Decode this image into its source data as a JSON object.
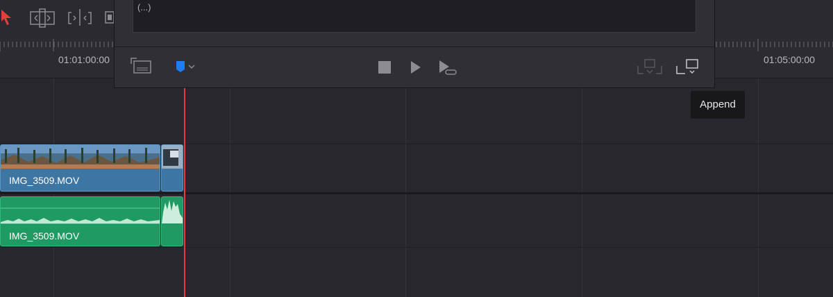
{
  "ruler": {
    "timecodes": [
      "01:01:00:00",
      "01:05:00:00"
    ]
  },
  "clips": {
    "video_clip_name": "IMG_3509.MOV",
    "audio_clip_name": "IMG_3509.MOV"
  },
  "render_panel": {
    "text_field_value": "(...)",
    "append_tooltip": "Append"
  },
  "colors": {
    "video_clip": "#3d76a3",
    "audio_clip": "#1f9a62",
    "playhead": "#e0413c",
    "marker_accent": "#1e7ef0",
    "pointer_tool": "#e0413c"
  },
  "icons": [
    "pointer-tool-icon",
    "trim-tool-icon",
    "dynamic-trim-icon",
    "blade-tool-icon",
    "render-cache-icon",
    "flag-marker-icon",
    "stop-icon",
    "play-icon",
    "play-loop-icon",
    "insert-icon",
    "append-icon"
  ]
}
